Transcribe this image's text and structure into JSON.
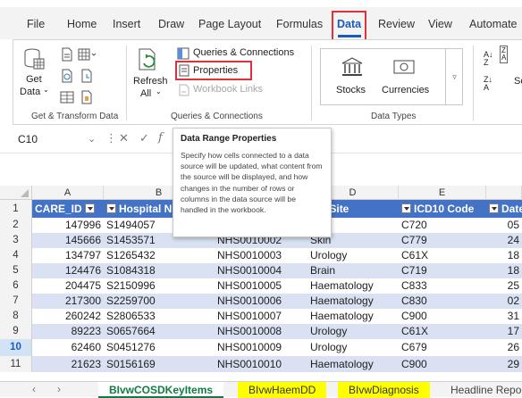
{
  "ribbon_tabs": [
    "File",
    "Home",
    "Insert",
    "Draw",
    "Page Layout",
    "Formulas",
    "Data",
    "Review",
    "View",
    "Automate"
  ],
  "active_tab": "Data",
  "groups": {
    "get_transform": {
      "label": "Get & Transform Data",
      "get_data": "Get",
      "get_data2": "Data"
    },
    "queries": {
      "label": "Queries & Connections",
      "refresh": "Refresh",
      "all": "All",
      "queries_connections": "Queries & Connections",
      "properties": "Properties",
      "workbook_links": "Workbook Links"
    },
    "data_types": {
      "label": "Data Types",
      "stocks": "Stocks",
      "currencies": "Currencies"
    },
    "sort": {
      "sort_label": "Sc"
    }
  },
  "formula_bar": {
    "name_box": "C10"
  },
  "tooltip": {
    "title": "Data Range Properties",
    "body": "Specify how cells connected to a data source will be updated, what content from the source will be displayed, and how changes in the number of rows or columns in the data source will be handled in the workbook."
  },
  "columns": [
    "A",
    "B",
    "C",
    "D",
    "E"
  ],
  "header": {
    "care_id": "CARE_ID",
    "hospital": "Hospital Num",
    "cancer_site": "cer Site",
    "icd10": "ICD10 Code",
    "date": "Date of"
  },
  "rows": [
    {
      "n": "2",
      "care_id": "147996",
      "hosp": "S1494057",
      "nhs": "",
      "site": "in",
      "icd": "C720",
      "date": "05"
    },
    {
      "n": "3",
      "care_id": "145666",
      "hosp": "S1453571",
      "nhs": "NHS0010002",
      "site": "Skin",
      "icd": "C779",
      "date": "24"
    },
    {
      "n": "4",
      "care_id": "134797",
      "hosp": "S1265432",
      "nhs": "NHS0010003",
      "site": "Urology",
      "icd": "C61X",
      "date": "18"
    },
    {
      "n": "5",
      "care_id": "124476",
      "hosp": "S1084318",
      "nhs": "NHS0010004",
      "site": "Brain",
      "icd": "C719",
      "date": "18"
    },
    {
      "n": "6",
      "care_id": "204475",
      "hosp": "S2150996",
      "nhs": "NHS0010005",
      "site": "Haematology",
      "icd": "C833",
      "date": "25"
    },
    {
      "n": "7",
      "care_id": "217300",
      "hosp": "S2259700",
      "nhs": "NHS0010006",
      "site": "Haematology",
      "icd": "C830",
      "date": "02"
    },
    {
      "n": "8",
      "care_id": "260242",
      "hosp": "S2806533",
      "nhs": "NHS0010007",
      "site": "Haematology",
      "icd": "C900",
      "date": "31"
    },
    {
      "n": "9",
      "care_id": "89223",
      "hosp": "S0657664",
      "nhs": "NHS0010008",
      "site": "Urology",
      "icd": "C61X",
      "date": "17"
    },
    {
      "n": "10",
      "care_id": "62460",
      "hosp": "S0451276",
      "nhs": "NHS0010009",
      "site": "Urology",
      "icd": "C679",
      "date": "26"
    },
    {
      "n": "11",
      "care_id": "21623",
      "hosp": "S0156169",
      "nhs": "NHS0010010",
      "site": "Haematology",
      "icd": "C900",
      "date": "29"
    }
  ],
  "header_row_num": "1",
  "sheet_tabs": [
    "BIvwCOSDKeyItems",
    "BIvwHaemDD",
    "BIvwDiagnosis",
    "Headline Report"
  ],
  "colors": {
    "header_blue": "#4472c4",
    "band": "#d9e1f2",
    "sheet_yellow": "#ffff00",
    "accent_red": "#e0303a"
  }
}
